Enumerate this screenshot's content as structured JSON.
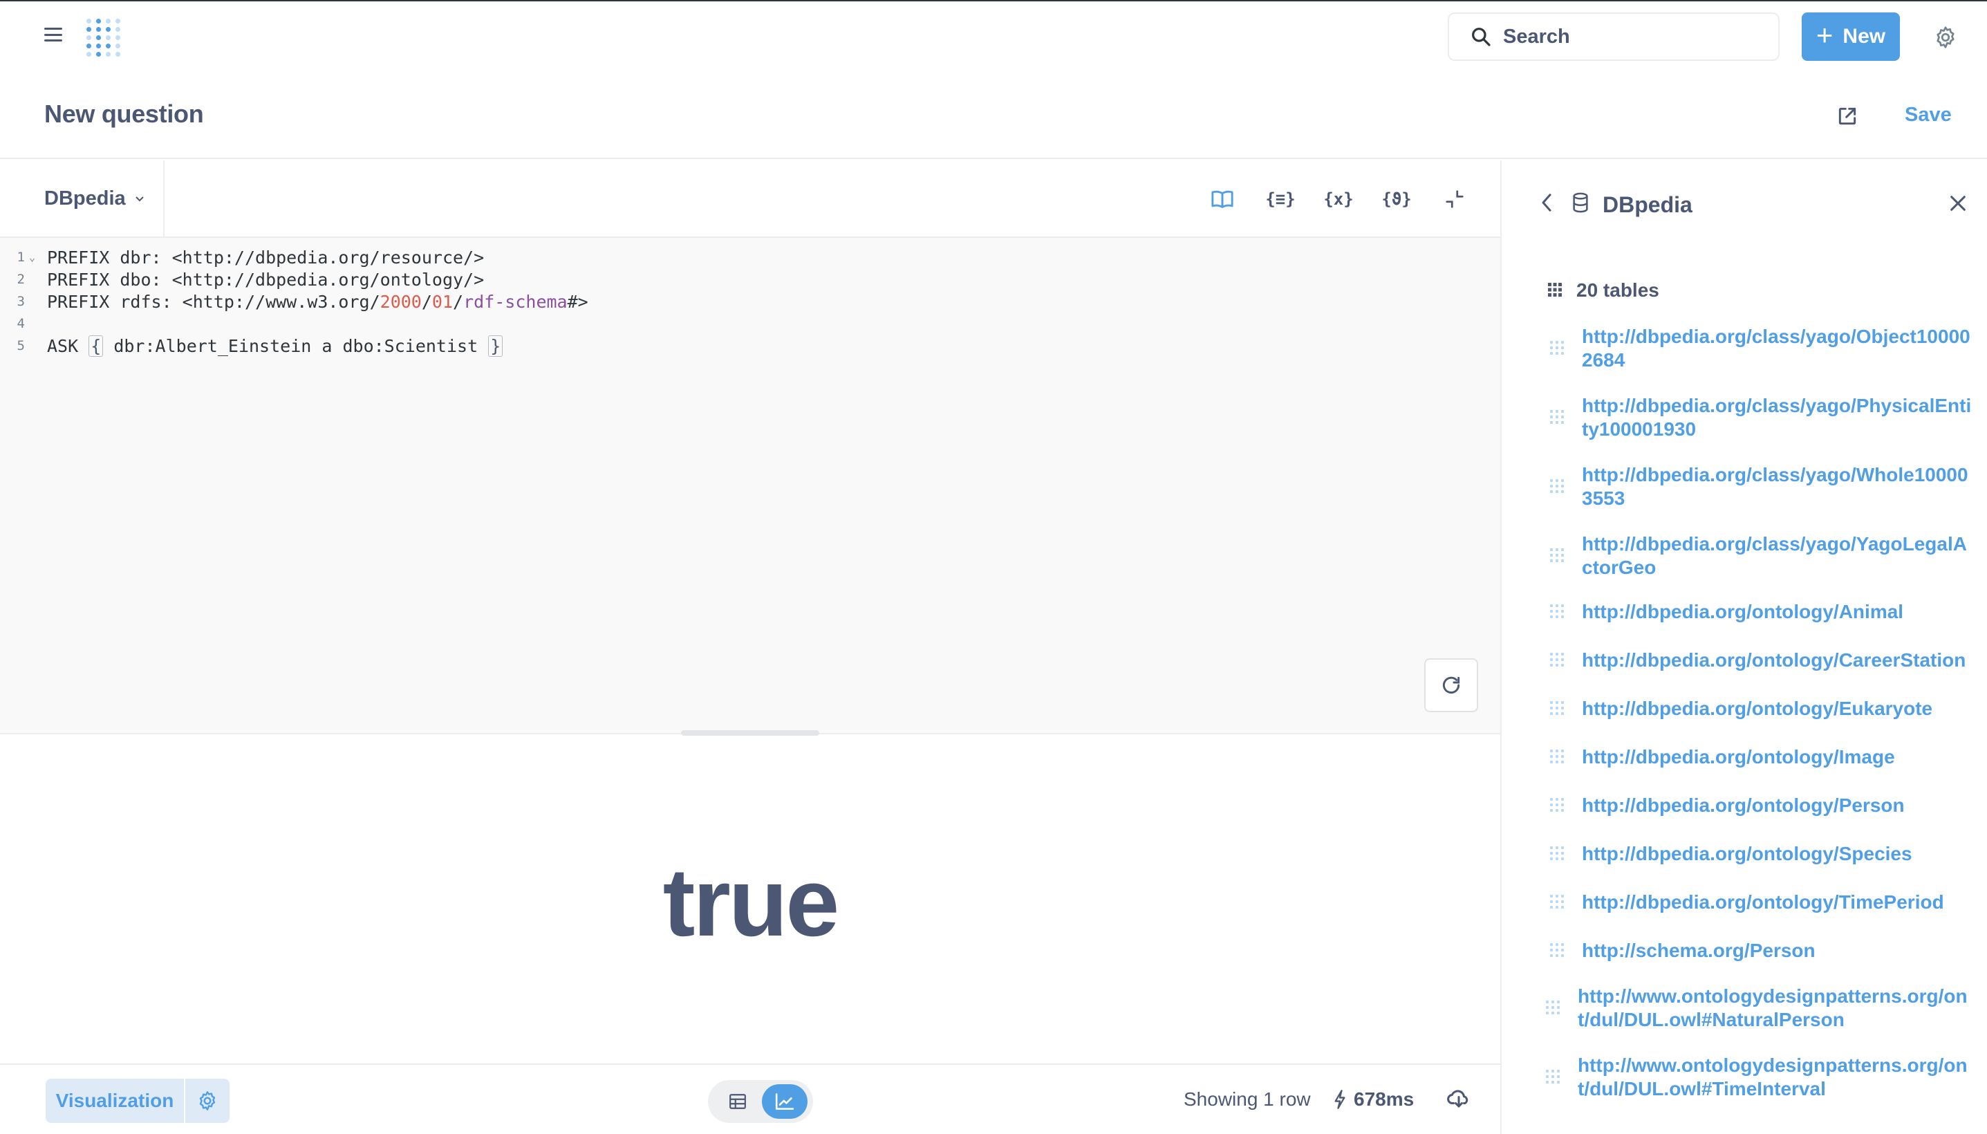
{
  "topbar": {
    "search_label": "Search",
    "new_label": "New"
  },
  "question": {
    "title": "New question",
    "save_label": "Save"
  },
  "editor": {
    "database": "DBpedia",
    "lines": [
      {
        "n": "1",
        "fold": true,
        "segments": [
          {
            "t": "PREFIX dbr: <http://dbpedia.org/resource/>"
          }
        ]
      },
      {
        "n": "2",
        "fold": false,
        "segments": [
          {
            "t": "PREFIX dbo: <http://dbpedia.org/ontology/>"
          }
        ]
      },
      {
        "n": "3",
        "fold": false,
        "segments": [
          {
            "t": "PREFIX rdfs: <http://www.w3.org/"
          },
          {
            "t": "2000",
            "c": "num"
          },
          {
            "t": "/"
          },
          {
            "t": "01",
            "c": "num"
          },
          {
            "t": "/"
          },
          {
            "t": "rdf-schema",
            "c": "sch"
          },
          {
            "t": "#>"
          }
        ]
      },
      {
        "n": "4",
        "fold": false,
        "segments": []
      },
      {
        "n": "5",
        "fold": false,
        "segments": [
          {
            "t": "ASK "
          },
          {
            "t": "{",
            "c": "brace"
          },
          {
            "t": " dbr:Albert_Einstein a dbo:Scientist "
          },
          {
            "t": "}",
            "c": "brace"
          }
        ]
      }
    ],
    "toolbar_icons": [
      "book-icon",
      "snippet-icon",
      "variable-icon",
      "function-icon",
      "collapse-icon"
    ]
  },
  "result": {
    "value": "true"
  },
  "footer": {
    "visualization_label": "Visualization",
    "row_count": "Showing 1 row",
    "timing": "678ms"
  },
  "sidebar": {
    "title": "DBpedia",
    "table_count": "20 tables",
    "tables": [
      "http://dbpedia.org/class/yago/Object100002684",
      "http://dbpedia.org/class/yago/PhysicalEntity100001930",
      "http://dbpedia.org/class/yago/Whole100003553",
      "http://dbpedia.org/class/yago/YagoLegalActorGeo",
      "http://dbpedia.org/ontology/Animal",
      "http://dbpedia.org/ontology/CareerStation",
      "http://dbpedia.org/ontology/Eukaryote",
      "http://dbpedia.org/ontology/Image",
      "http://dbpedia.org/ontology/Person",
      "http://dbpedia.org/ontology/Species",
      "http://dbpedia.org/ontology/TimePeriod",
      "http://schema.org/Person",
      "http://www.ontologydesignpatterns.org/ont/dul/DUL.owl#NaturalPerson",
      "http://www.ontologydesignpatterns.org/ont/dul/DUL.owl#TimeInterval"
    ]
  },
  "colors": {
    "brand": "#509ee3",
    "text": "#4c5773",
    "editor_bg": "#f9f9fa",
    "code_number": "#e05a4a",
    "code_schema": "#8a4f9e"
  }
}
